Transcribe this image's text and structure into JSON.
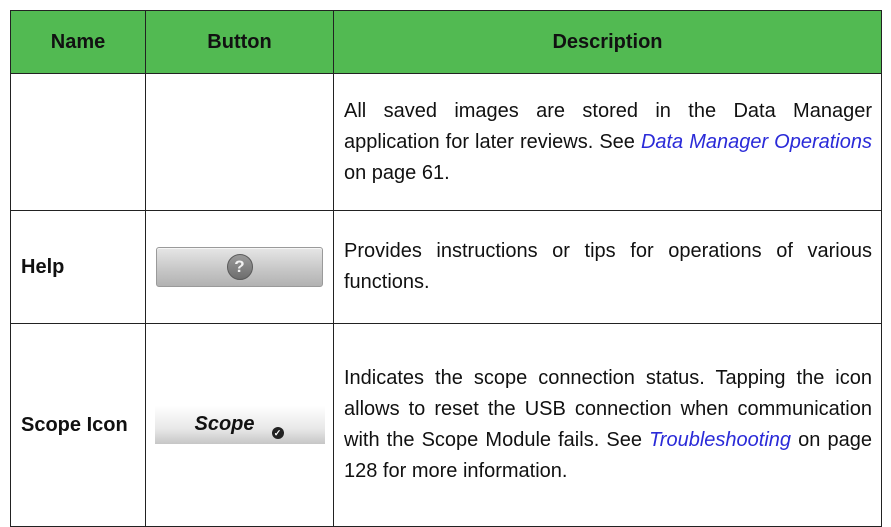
{
  "table": {
    "headers": {
      "name": "Name",
      "button": "Button",
      "description": "Description"
    },
    "rows": [
      {
        "name": "",
        "desc_text": "All saved images are stored in the Data Manager application for later reviews. See ",
        "desc_link": "Data Manager Operations",
        "desc_after": " on page 61."
      },
      {
        "name": "Help",
        "button_icon": "help-question-icon",
        "button_glyph": "?",
        "desc_text": "Provides instructions or tips for operations of various functions."
      },
      {
        "name": "Scope Icon",
        "button_label": "Scope",
        "button_icon": "check-badge-icon",
        "button_glyph": "✓",
        "desc_text": "Indicates the scope connection status. Tapping the icon allows to reset the USB connection when communication with the Scope Module fails. See ",
        "desc_link": "Troubleshooting",
        "desc_after": " on page 128 for more information."
      }
    ]
  },
  "colors": {
    "header_bg": "#52ba52",
    "link": "#2a2ad8"
  }
}
